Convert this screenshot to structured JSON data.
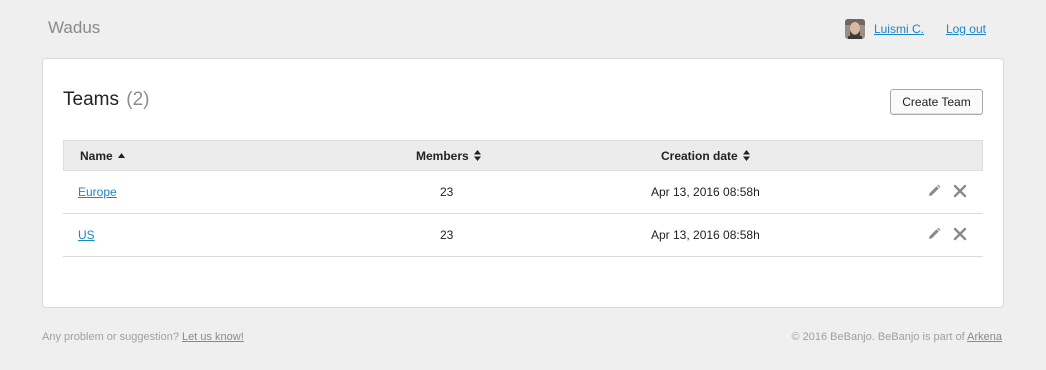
{
  "header": {
    "brand": "Wadus",
    "user_name": "Luismi C.",
    "logout_label": "Log out"
  },
  "teams": {
    "title": "Teams",
    "count": "(2)",
    "create_label": "Create Team",
    "columns": {
      "name": "Name",
      "members": "Members",
      "creation_date": "Creation date"
    },
    "rows": [
      {
        "name": "Europe",
        "members": "23",
        "creation_date": "Apr 13, 2016 08:58h"
      },
      {
        "name": "US",
        "members": "23",
        "creation_date": "Apr 13, 2016 08:58h"
      }
    ]
  },
  "footer": {
    "left_text": "Any problem or suggestion?",
    "left_link": "Let us know!",
    "right_text": "© 2016 BeBanjo. BeBanjo is part of",
    "right_link": "Arkena"
  },
  "colors": {
    "link": "#1a86c8",
    "background": "#efefef",
    "card": "#ffffff",
    "header_row": "#ececec",
    "icon": "#8a8a8a"
  },
  "icons": {
    "sort_asc": "caret-up-icon",
    "sort_both": "sort-icon",
    "edit": "pencil-icon",
    "delete": "close-icon"
  }
}
